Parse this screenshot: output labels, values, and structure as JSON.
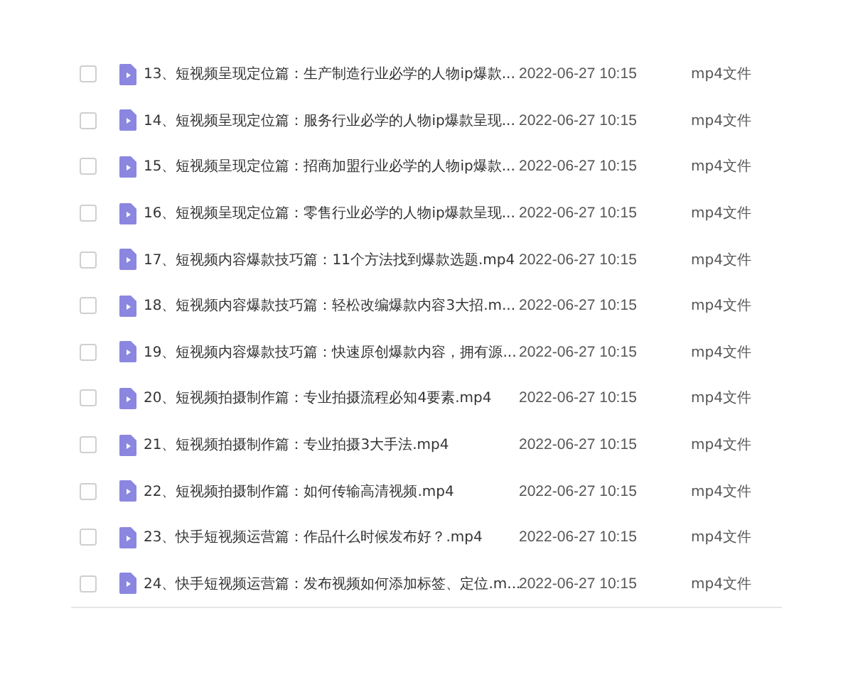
{
  "files": [
    {
      "name": "13、短视频呈现定位篇：生产制造行业必学的人物ip爆款...",
      "date": "2022-06-27 10:15",
      "type": "mp4文件",
      "checked": false
    },
    {
      "name": "14、短视频呈现定位篇：服务行业必学的人物ip爆款呈现...",
      "date": "2022-06-27 10:15",
      "type": "mp4文件",
      "checked": false
    },
    {
      "name": "15、短视频呈现定位篇：招商加盟行业必学的人物ip爆款...",
      "date": "2022-06-27 10:15",
      "type": "mp4文件",
      "checked": false
    },
    {
      "name": "16、短视频呈现定位篇：零售行业必学的人物ip爆款呈现...",
      "date": "2022-06-27 10:15",
      "type": "mp4文件",
      "checked": false
    },
    {
      "name": "17、短视频内容爆款技巧篇：11个方法找到爆款选题.mp4",
      "date": "2022-06-27 10:15",
      "type": "mp4文件",
      "checked": false
    },
    {
      "name": "18、短视频内容爆款技巧篇：轻松改编爆款内容3大招.m...",
      "date": "2022-06-27 10:15",
      "type": "mp4文件",
      "checked": false
    },
    {
      "name": "19、短视频内容爆款技巧篇：快速原创爆款内容，拥有源...",
      "date": "2022-06-27 10:15",
      "type": "mp4文件",
      "checked": false
    },
    {
      "name": "20、短视频拍摄制作篇：专业拍摄流程必知4要素.mp4",
      "date": "2022-06-27 10:15",
      "type": "mp4文件",
      "checked": false
    },
    {
      "name": "21、短视频拍摄制作篇：专业拍摄3大手法.mp4",
      "date": "2022-06-27 10:15",
      "type": "mp4文件",
      "checked": false
    },
    {
      "name": "22、短视频拍摄制作篇：如何传输高清视频.mp4",
      "date": "2022-06-27 10:15",
      "type": "mp4文件",
      "checked": false
    },
    {
      "name": "23、快手短视频运营篇：作品什么时候发布好？.mp4",
      "date": "2022-06-27 10:15",
      "type": "mp4文件",
      "checked": false
    },
    {
      "name": "24、快手短视频运营篇：发布视频如何添加标签、定位.m...",
      "date": "2022-06-27 10:15",
      "type": "mp4文件",
      "checked": false
    }
  ]
}
